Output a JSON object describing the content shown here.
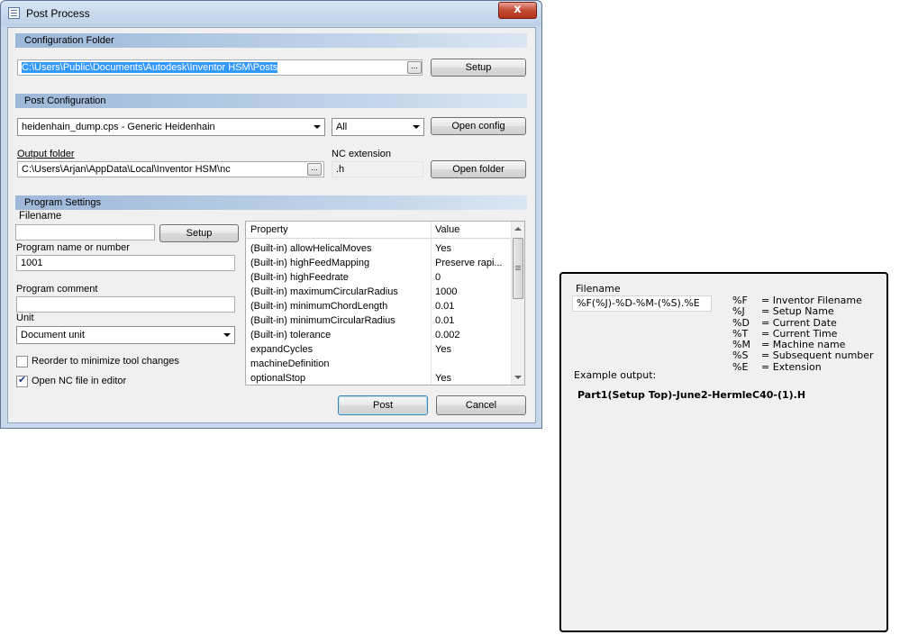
{
  "window": {
    "title": "Post Process",
    "close_glyph": "x"
  },
  "config_folder": {
    "header": "Configuration Folder",
    "path": "C:\\Users\\Public\\Documents\\Autodesk\\Inventor HSM\\Posts",
    "browse": "...",
    "setup": "Setup"
  },
  "post_config": {
    "header": "Post Configuration",
    "post_select": "heidenhain_dump.cps - Generic Heidenhain",
    "filter_select": "All",
    "open_config": "Open config"
  },
  "output": {
    "folder_label": "Output folder",
    "folder_path": "C:\\Users\\Arjan\\AppData\\Local\\Inventor HSM\\nc",
    "browse": "...",
    "ext_label": "NC extension",
    "ext_value": ".h",
    "open_folder": "Open folder"
  },
  "program": {
    "header": "Program Settings",
    "filename_label": "Filename",
    "filename_value": "",
    "setup": "Setup",
    "name_label": "Program name or number",
    "name_value": "1001",
    "comment_label": "Program comment",
    "comment_value": "",
    "unit_label": "Unit",
    "unit_value": "Document unit",
    "reorder_label": "Reorder to minimize tool changes",
    "reorder_checked": false,
    "open_nc_label": "Open NC file in editor",
    "open_nc_checked": true
  },
  "properties": {
    "col_property": "Property",
    "col_value": "Value",
    "rows": [
      {
        "property": "(Built-in) allowHelicalMoves",
        "value": "Yes"
      },
      {
        "property": "(Built-in) highFeedMapping",
        "value": "Preserve rapi..."
      },
      {
        "property": "(Built-in) highFeedrate",
        "value": "0"
      },
      {
        "property": "(Built-in) maximumCircularRadius",
        "value": "1000"
      },
      {
        "property": "(Built-in) minimumChordLength",
        "value": "0.01"
      },
      {
        "property": "(Built-in) minimumCircularRadius",
        "value": "0.01"
      },
      {
        "property": "(Built-in) tolerance",
        "value": "0.002"
      },
      {
        "property": "expandCycles",
        "value": "Yes"
      },
      {
        "property": "machineDefinition",
        "value": ""
      },
      {
        "property": "optionalStop",
        "value": "Yes"
      }
    ]
  },
  "buttons": {
    "post": "Post",
    "cancel": "Cancel"
  },
  "help": {
    "title": "Filename",
    "pattern": "%F(%J)-%D-%M-(%S).%E",
    "codes": [
      {
        "code": "%F",
        "desc": "= Inventor Filename"
      },
      {
        "code": "%J",
        "desc": "= Setup Name"
      },
      {
        "code": "%D",
        "desc": "= Current Date"
      },
      {
        "code": "%T",
        "desc": "= Current Time"
      },
      {
        "code": "%M",
        "desc": "= Machine name"
      },
      {
        "code": "%S",
        "desc": "= Subsequent number"
      },
      {
        "code": "%E",
        "desc": "= Extension"
      }
    ],
    "example_label": "Example output:",
    "example_value": "Part1(Setup Top)-June2-HermleC40-(1).H"
  },
  "colors": {
    "selection": "#3399ff",
    "section_header": "#9db8d9",
    "close_button": "#c44b33",
    "checkmark": "#1a3e8c"
  }
}
